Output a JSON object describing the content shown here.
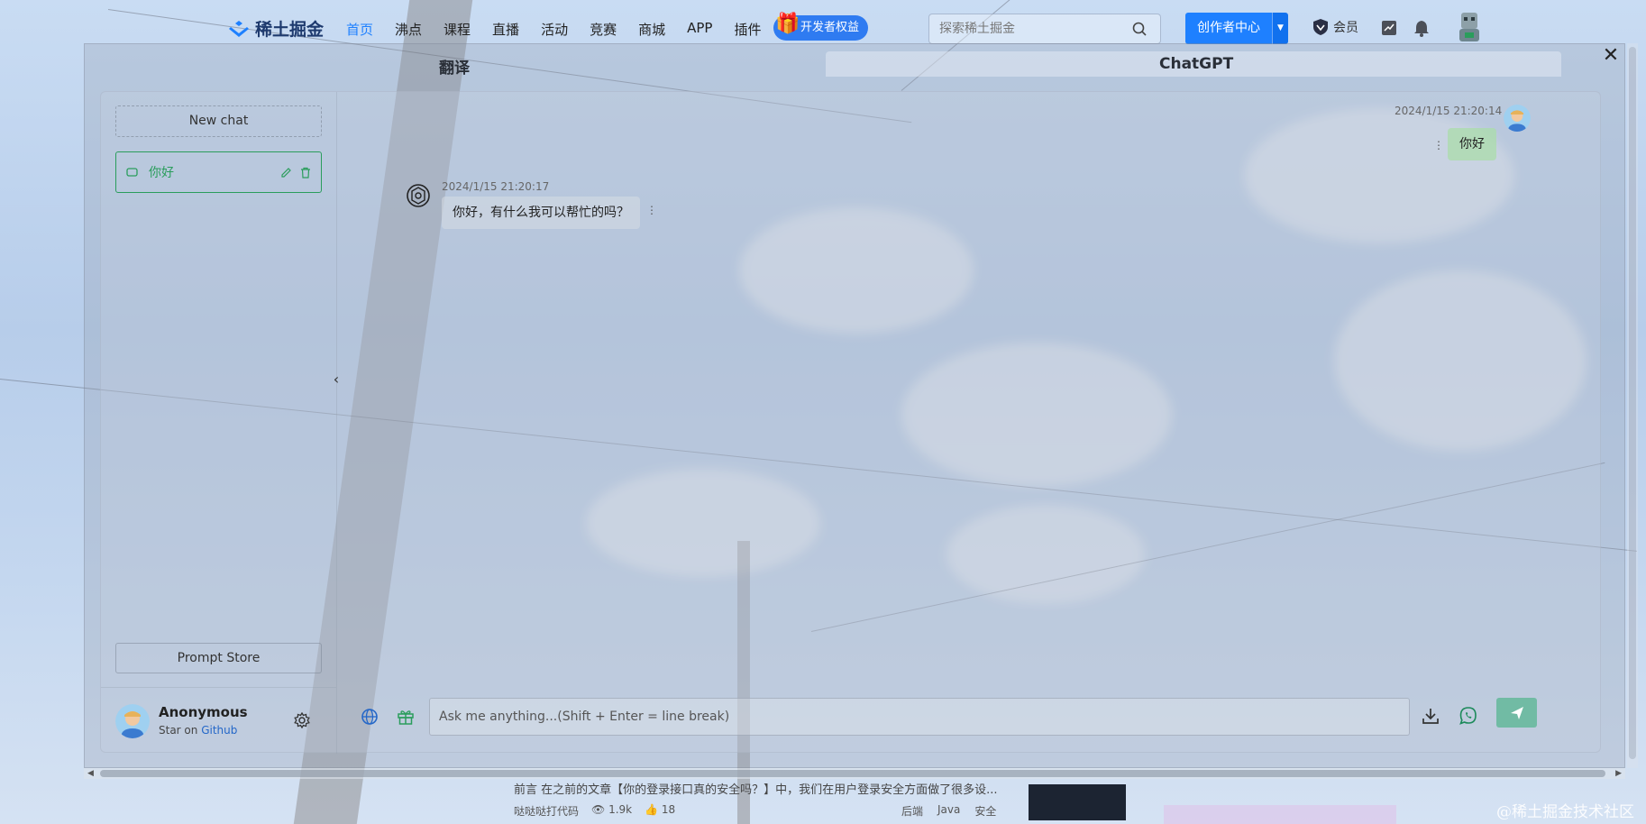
{
  "site": {
    "logo_text": "稀土掘金",
    "nav": [
      "首页",
      "沸点",
      "课程",
      "直播",
      "活动",
      "竞赛",
      "商城",
      "APP",
      "插件"
    ],
    "active_nav": "首页",
    "dev_badge": "开发者权益",
    "search_placeholder": "探索稀土掘金",
    "creator_button": "创作者中心",
    "vip_label": "会员"
  },
  "panel": {
    "tab_translate": "翻译",
    "tab_chatgpt": "ChatGPT"
  },
  "chat": {
    "new_chat_label": "New chat",
    "history": [
      {
        "title": "你好"
      }
    ],
    "prompt_store_label": "Prompt Store",
    "user": {
      "name": "Anonymous",
      "subtitle_prefix": "Star on ",
      "subtitle_link": "Github"
    },
    "messages": [
      {
        "role": "user",
        "time": "2024/1/15 21:20:14",
        "text": "你好"
      },
      {
        "role": "assistant",
        "time": "2024/1/15 21:20:17",
        "text": "你好，有什么我可以帮忙的吗？"
      }
    ],
    "input_placeholder": "Ask me anything...(Shift + Enter = line break)"
  },
  "background_page": {
    "article_snippet": "前言 在之前的文章【你的登录接口真的安全吗？】中，我们在用户登录安全方面做了很多设...",
    "author": "哒哒哒打代码",
    "views": "1.9k",
    "likes": "18",
    "tags": [
      "后端",
      "Java",
      "安全"
    ],
    "watermark": "@稀土掘金技术社区"
  },
  "colors": {
    "brand_blue": "#1e80ff",
    "active_green": "#2a9d5c",
    "send_green": "#50b48c"
  }
}
